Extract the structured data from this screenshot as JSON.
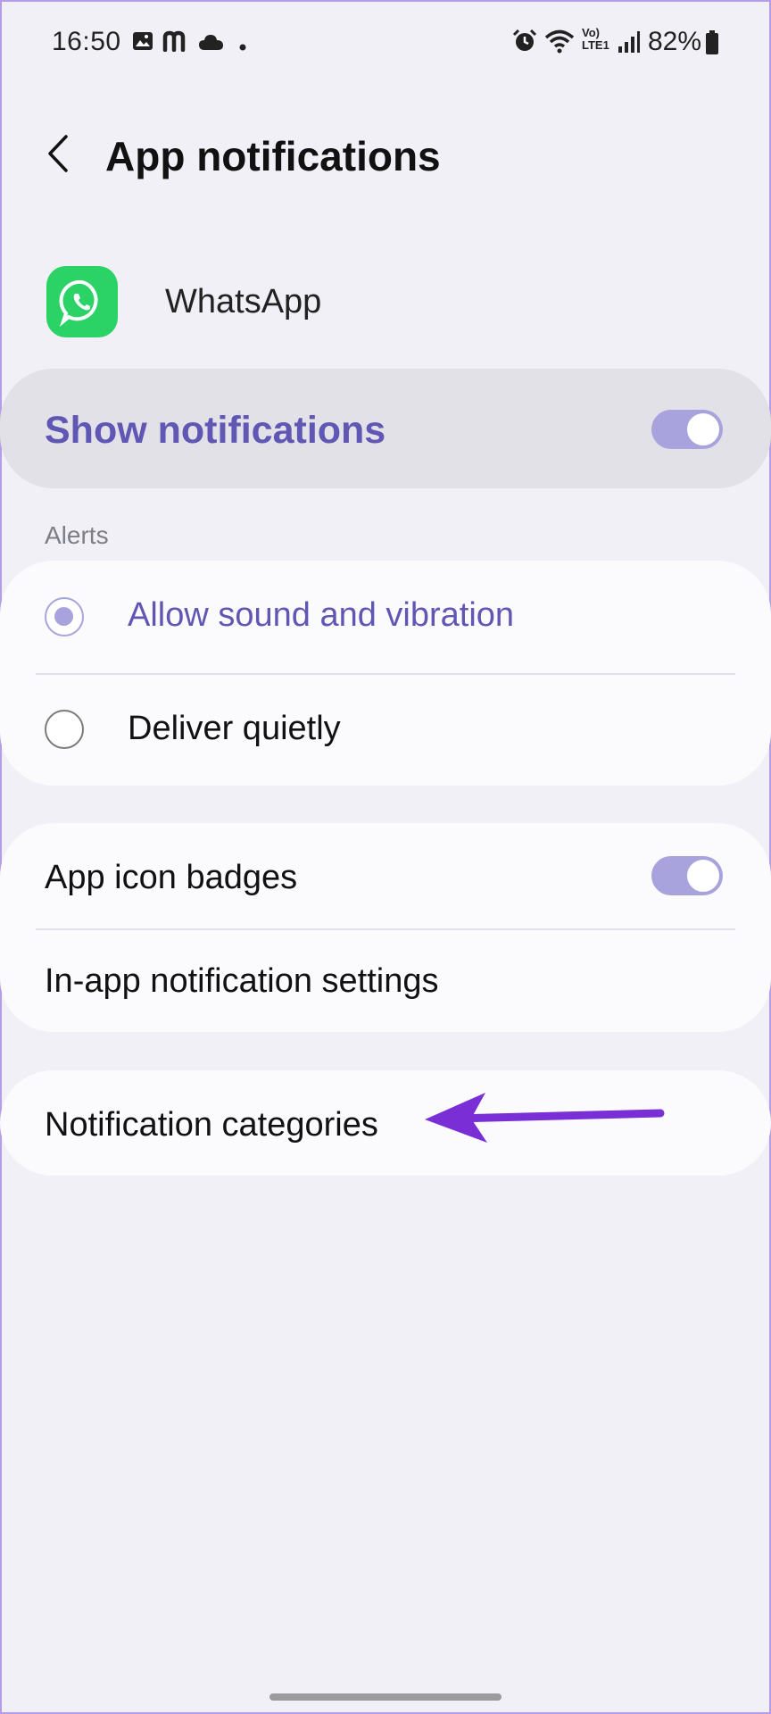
{
  "status_bar": {
    "time": "16:50",
    "battery": "82%",
    "network": "Vo) LTE1",
    "icons": [
      "gallery-icon",
      "m-app-icon",
      "cloud-icon",
      "dot-icon",
      "alarm-icon",
      "wifi-icon",
      "lte-icon",
      "signal-icon",
      "battery-icon"
    ]
  },
  "header": {
    "title": "App notifications"
  },
  "app": {
    "name": "WhatsApp",
    "icon": "whatsapp-icon"
  },
  "show_notifications": {
    "label": "Show notifications",
    "enabled": true
  },
  "alerts": {
    "section_label": "Alerts",
    "options": [
      {
        "label": "Allow sound and vibration",
        "selected": true
      },
      {
        "label": "Deliver quietly",
        "selected": false
      }
    ]
  },
  "badges_card": {
    "app_icon_badges": {
      "label": "App icon badges",
      "enabled": true
    },
    "in_app_settings": {
      "label": "In-app notification settings"
    }
  },
  "categories": {
    "label": "Notification categories"
  },
  "colors": {
    "accent": "#6056b3",
    "toggle": "#a8a3dc",
    "annotation_arrow": "#7a2ed6",
    "whatsapp_green": "#2bd366"
  }
}
